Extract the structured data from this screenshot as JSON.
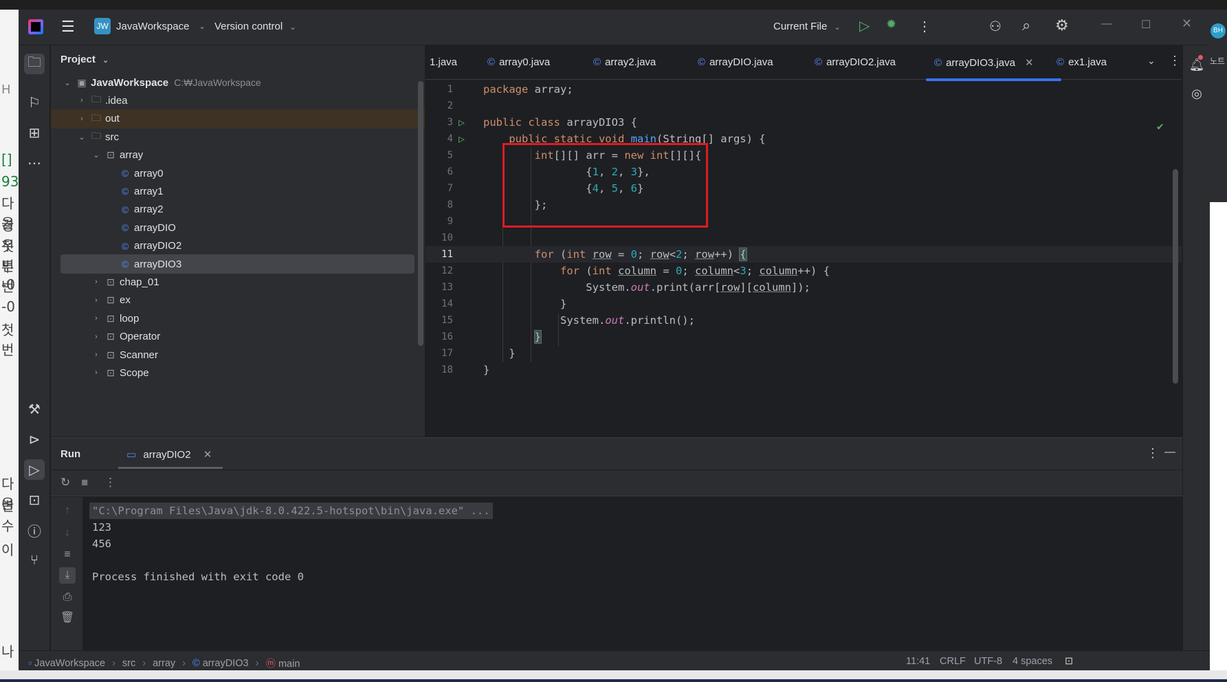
{
  "window": {
    "project_badge": "JW",
    "project_name": "JavaWorkspace",
    "version_control": "Version control",
    "run_config": "Current File"
  },
  "project_panel": {
    "title": "Project",
    "tree": [
      {
        "label": "JavaWorkspace",
        "path": "C:₩JavaWorkspace",
        "depth": 0,
        "type": "module",
        "expanded": true
      },
      {
        "label": ".idea",
        "depth": 1,
        "type": "folder",
        "expanded": false
      },
      {
        "label": "out",
        "depth": 1,
        "type": "folder-out",
        "expanded": false
      },
      {
        "label": "src",
        "depth": 1,
        "type": "folder",
        "expanded": true
      },
      {
        "label": "array",
        "depth": 2,
        "type": "package",
        "expanded": true
      },
      {
        "label": "array0",
        "depth": 3,
        "type": "class"
      },
      {
        "label": "array1",
        "depth": 3,
        "type": "class"
      },
      {
        "label": "array2",
        "depth": 3,
        "type": "class"
      },
      {
        "label": "arrayDIO",
        "depth": 3,
        "type": "class"
      },
      {
        "label": "arrayDIO2",
        "depth": 3,
        "type": "class"
      },
      {
        "label": "arrayDIO3",
        "depth": 3,
        "type": "class",
        "selected": true
      },
      {
        "label": "chap_01",
        "depth": 2,
        "type": "package",
        "expanded": false
      },
      {
        "label": "ex",
        "depth": 2,
        "type": "package",
        "expanded": false
      },
      {
        "label": "loop",
        "depth": 2,
        "type": "package",
        "expanded": false
      },
      {
        "label": "Operator",
        "depth": 2,
        "type": "package",
        "expanded": false
      },
      {
        "label": "Scanner",
        "depth": 2,
        "type": "package",
        "expanded": false
      },
      {
        "label": "Scope",
        "depth": 2,
        "type": "package",
        "expanded": false
      }
    ]
  },
  "editor": {
    "tabs": [
      {
        "label": "1.java"
      },
      {
        "label": "array0.java"
      },
      {
        "label": "array2.java"
      },
      {
        "label": "arrayDIO.java"
      },
      {
        "label": "arrayDIO2.java"
      },
      {
        "label": "arrayDIO3.java",
        "active": true
      },
      {
        "label": "ex1.java"
      }
    ],
    "current_line": 11,
    "line_numbers": [
      "1",
      "2",
      "3",
      "4",
      "5",
      "6",
      "7",
      "8",
      "9",
      "10",
      "11",
      "12",
      "13",
      "14",
      "15",
      "16",
      "17",
      "18"
    ]
  },
  "run_panel": {
    "title": "Run",
    "tab": "arrayDIO2",
    "output": [
      "\"C:\\Program Files\\Java\\jdk-8.0.422.5-hotspot\\bin\\java.exe\" ...",
      "123",
      "456",
      "",
      "Process finished with exit code 0"
    ]
  },
  "status_bar": {
    "breadcrumbs": [
      "JavaWorkspace",
      "src",
      "array",
      "arrayDIO3",
      "main"
    ],
    "position": "11:41",
    "line_ending": "CRLF",
    "encoding": "UTF-8",
    "indent": "4 spaces"
  },
  "background": {
    "right_edge_text": "BH",
    "right_edge_text2": "노트",
    "left_edge_glyphs": [
      "H",
      "[]",
      "93",
      "다음",
      "경우",
      "첫번",
      "두번",
      "-0",
      "-0",
      "첫번",
      "다음",
      "변수",
      "이",
      "나"
    ]
  },
  "colors": {
    "keyword": "#cf8e6d",
    "number": "#2aacb8",
    "method": "#56a8f5",
    "static_field": "#c77dbb",
    "run_icon": "#59a869",
    "highlight_box": "#e01b24",
    "accent": "#3574f0"
  }
}
